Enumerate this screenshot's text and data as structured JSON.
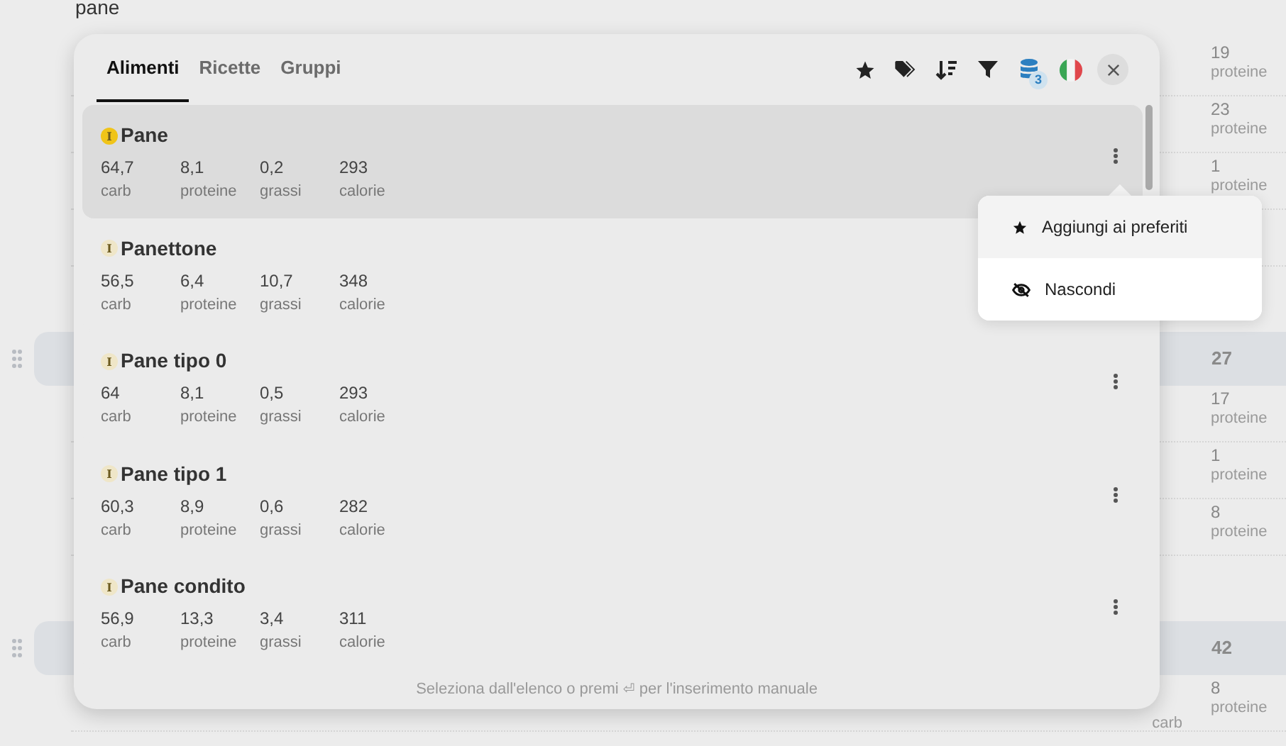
{
  "background": {
    "search_text": "pane",
    "rows": [
      {
        "kind": "cell",
        "value": "19",
        "label": "proteine"
      },
      {
        "kind": "cell",
        "value": "23",
        "label": "proteine"
      },
      {
        "kind": "cell",
        "value": "1",
        "label": "proteine"
      },
      {
        "kind": "empty"
      },
      {
        "kind": "spacer"
      },
      {
        "kind": "header",
        "value": "27"
      },
      {
        "kind": "cell",
        "value": "17",
        "label": "proteine"
      },
      {
        "kind": "cell",
        "value": "1",
        "label": "proteine"
      },
      {
        "kind": "cell",
        "value": "8",
        "label": "proteine"
      },
      {
        "kind": "spacer"
      },
      {
        "kind": "header",
        "value": "42"
      },
      {
        "kind": "cell",
        "value": "8",
        "label": "proteine",
        "extra_label": "carb"
      }
    ]
  },
  "tabs": [
    {
      "label": "Alimenti",
      "selected": true
    },
    {
      "label": "Ricette",
      "selected": false
    },
    {
      "label": "Gruppi",
      "selected": false
    }
  ],
  "toolbar": {
    "database_count": "3"
  },
  "items": [
    {
      "name": "Pane",
      "badge": "I",
      "color": "#f0c419",
      "selected": true,
      "values": [
        {
          "value": "64,7",
          "label": "carb"
        },
        {
          "value": "8,1",
          "label": "proteine"
        },
        {
          "value": "0,2",
          "label": "grassi"
        },
        {
          "value": "293",
          "label": "calorie"
        }
      ]
    },
    {
      "name": "Panettone",
      "badge": "I",
      "color": "#efe6c8",
      "selected": false,
      "values": [
        {
          "value": "56,5",
          "label": "carb"
        },
        {
          "value": "6,4",
          "label": "proteine"
        },
        {
          "value": "10,7",
          "label": "grassi"
        },
        {
          "value": "348",
          "label": "calorie"
        }
      ]
    },
    {
      "name": "Pane tipo 0",
      "badge": "I",
      "color": "#efe6c8",
      "selected": false,
      "values": [
        {
          "value": "64",
          "label": "carb"
        },
        {
          "value": "8,1",
          "label": "proteine"
        },
        {
          "value": "0,5",
          "label": "grassi"
        },
        {
          "value": "293",
          "label": "calorie"
        }
      ]
    },
    {
      "name": "Pane tipo 1",
      "badge": "I",
      "color": "#efe6c8",
      "selected": false,
      "values": [
        {
          "value": "60,3",
          "label": "carb"
        },
        {
          "value": "8,9",
          "label": "proteine"
        },
        {
          "value": "0,6",
          "label": "grassi"
        },
        {
          "value": "282",
          "label": "calorie"
        }
      ]
    },
    {
      "name": "Pane condito",
      "badge": "I",
      "color": "#efe6c8",
      "selected": false,
      "values": [
        {
          "value": "56,9",
          "label": "carb"
        },
        {
          "value": "13,3",
          "label": "proteine"
        },
        {
          "value": "3,4",
          "label": "grassi"
        },
        {
          "value": "311",
          "label": "calorie"
        }
      ]
    }
  ],
  "menu": [
    {
      "kind": "favorite",
      "label": "Aggiungi ai preferiti",
      "selected": true
    },
    {
      "kind": "hide",
      "label": "Nascondi",
      "selected": false
    }
  ],
  "footer": {
    "before": "Seleziona dall'elenco o premi",
    "key": "⏎",
    "after": "per l'inserimento manuale"
  }
}
